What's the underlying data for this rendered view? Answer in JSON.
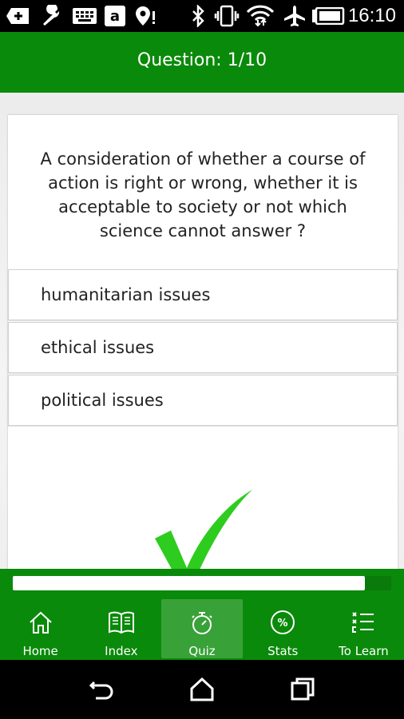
{
  "status_bar": {
    "time": "16:10",
    "icons": [
      "add-icon",
      "wrench-icon",
      "keyboard-icon",
      "amazon-icon",
      "location-alert-icon",
      "bluetooth-icon",
      "vibrate-icon",
      "wifi-icon",
      "airplane-icon",
      "battery-icon"
    ]
  },
  "app_bar": {
    "title": "Question: 1/10"
  },
  "question": {
    "text": "A consideration of whether a course of action is right or wrong, whether it is acceptable to society or not which science cannot answer ?"
  },
  "answers": [
    {
      "label": "humanitarian issues"
    },
    {
      "label": "ethical issues"
    },
    {
      "label": "political issues"
    }
  ],
  "feedback": {
    "icon": "checkmark-icon",
    "color": "#2ecc1e"
  },
  "progress": {
    "fraction": 0.93
  },
  "bottom_nav": {
    "items": [
      {
        "label": "Home",
        "icon": "home-icon"
      },
      {
        "label": "Index",
        "icon": "book-icon"
      },
      {
        "label": "Quiz",
        "icon": "stopwatch-icon",
        "active": true
      },
      {
        "label": "Stats",
        "icon": "percent-icon"
      },
      {
        "label": "To Learn",
        "icon": "checklist-icon"
      }
    ]
  },
  "colors": {
    "primary": "#0a8a0a",
    "active_tab": "#38a238"
  }
}
